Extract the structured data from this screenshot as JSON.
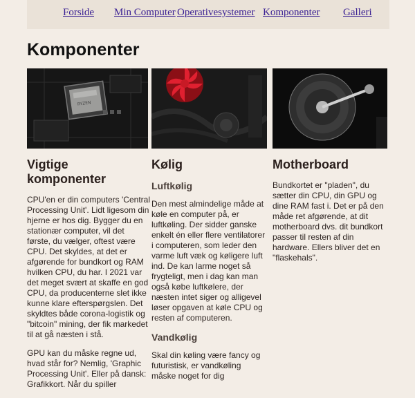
{
  "nav": {
    "items": [
      "Forside",
      "Min Computer",
      "Operativesystemer",
      "Komponenter",
      "Galleri"
    ]
  },
  "page": {
    "title": "Komponenter"
  },
  "images": [
    {
      "alt": "CPU på bundkort"
    },
    {
      "alt": "Rød blæser og køler"
    },
    {
      "alt": "Åben harddisk"
    }
  ],
  "columns": {
    "left": {
      "heading": "Vigtige komponenter",
      "paragraphs": [
        "CPU'en er din computers 'Central Processing Unit'. Lidt ligesom din hjerne er hos dig. Bygger du en stationær computer, vil det første, du vælger, oftest være CPU. Det skyldes, at det er afgørende for bundkort og RAM hvilken CPU, du har. I 2021 var det meget svært at skaffe en god CPU, da producenterne slet ikke kunne klare efterspørgslen. Det skyldtes både corona-logistik og \"bitcoin\" mining, der fik markedet til at gå næsten i stå.",
        "GPU kan du måske regne ud, hvad står for? Nemlig, 'Graphic Processing Unit'. Eller på dansk: Grafikkort. Når du spiller"
      ]
    },
    "middle": {
      "heading": "Kølig",
      "sub1": "Luftkølig",
      "p1": "Den mest almindelige måde at køle en computer på, er luftkøling. Der sidder ganske enkelt én eller flere ventilatorer i computeren, som leder den varme luft væk og køligere luft ind. De kan larme noget så frygteligt, men i dag kan man også købe luftkølere, der næsten intet siger og alligevel løser opgaven at køle CPU og resten af computeren.",
      "sub2": "Vandkølig",
      "p2": "Skal din køling være fancy og futuristisk, er vandkøling måske noget for dig"
    },
    "right": {
      "heading": "Motherboard",
      "p1": "Bundkortet er \"pladen\", du sætter din CPU, din GPU og dine RAM fast i. Det er på den måde ret afgørende, at dit motherboard dvs. dit bundkort passer til resten af din hardware. Ellers bliver det en \"flaskehals\"."
    }
  }
}
